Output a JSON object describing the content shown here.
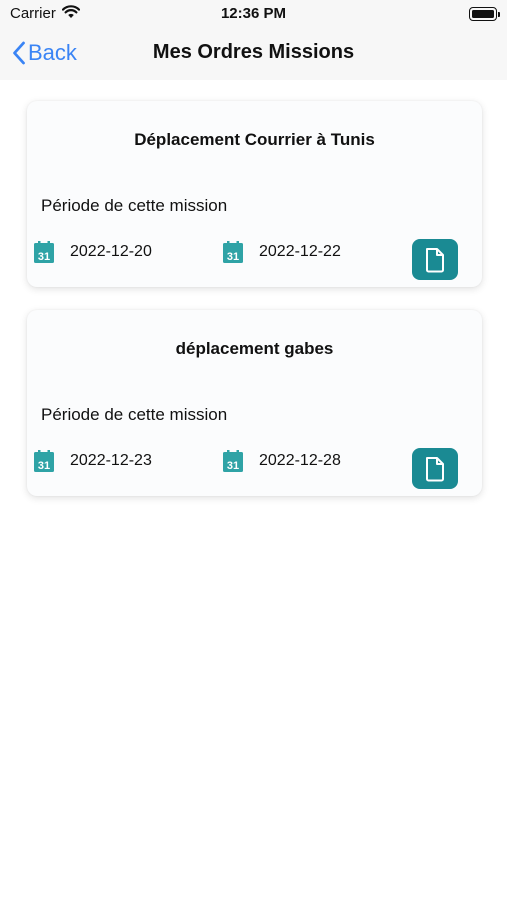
{
  "status_bar": {
    "carrier": "Carrier",
    "time": "12:36 PM"
  },
  "nav": {
    "back_label": "Back",
    "title": "Mes Ordres Missions",
    "accent_color": "#3a84f5"
  },
  "missions": [
    {
      "title": "Déplacement Courrier à Tunis",
      "period_label": "Période de cette mission",
      "start_date": "2022-12-20",
      "end_date": "2022-12-22",
      "calendar_icon_day": "31"
    },
    {
      "title": "déplacement gabes",
      "period_label": "Période de cette mission",
      "start_date": "2022-12-23",
      "end_date": "2022-12-28",
      "calendar_icon_day": "31"
    }
  ],
  "theme": {
    "teal": "#1a8a93",
    "icon_teal": "#2fa3a6"
  }
}
